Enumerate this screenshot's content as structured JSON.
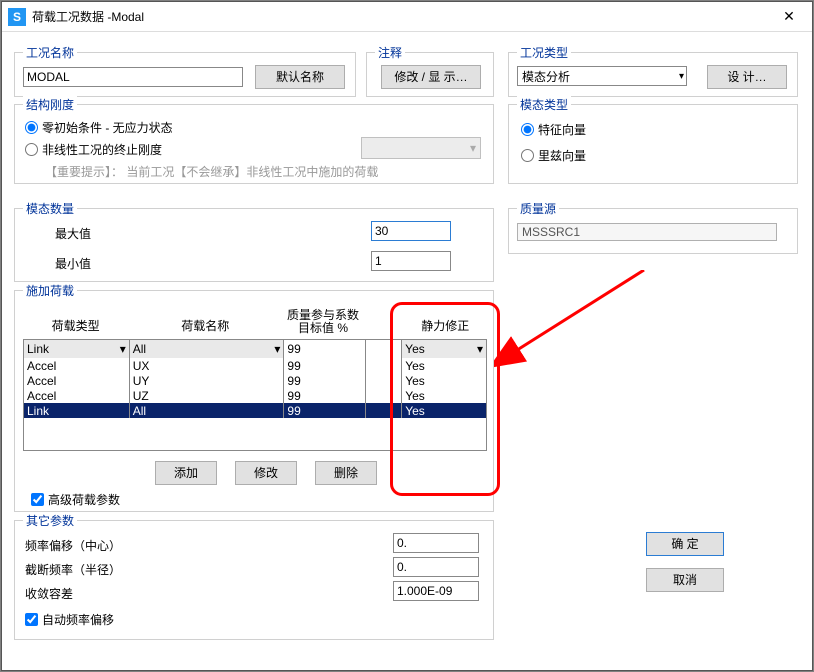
{
  "window": {
    "title": "荷载工况数据 -Modal",
    "app_letter": "S",
    "close_icon": "✕"
  },
  "group_name": {
    "title": "工况名称",
    "value": "MODAL",
    "default_btn": "默认名称"
  },
  "group_notes": {
    "title": "注释",
    "btn": "修改 / 显 示…"
  },
  "group_type": {
    "title": "工况类型",
    "value": "模态分析",
    "design_btn": "设 计…",
    "arrow": "▾"
  },
  "group_struct": {
    "title": "结构刚度",
    "radio1": "零初始条件 - 无应力状态",
    "radio2": "非线性工况的终止刚度",
    "hint": "【重要提示】：   当前工况【不会继承】非线性工况中施加的荷载",
    "dd_arrow": "▾"
  },
  "group_modal_type": {
    "title": "模态类型",
    "radio1": "特征向量",
    "radio2": "里兹向量"
  },
  "group_num": {
    "title": "模态数量",
    "max_label": "最大值",
    "max_value": "30",
    "min_label": "最小值",
    "min_value": "1"
  },
  "group_mass": {
    "title": "质量源",
    "value": "MSSSRC1"
  },
  "group_loads": {
    "title": "施加荷载",
    "hdr_type": "荷载类型",
    "hdr_name": "荷载名称",
    "hdr_target1": "质量参与系数",
    "hdr_target2": "目标值 %",
    "hdr_static": "静力修正",
    "row_head": {
      "a": "Link",
      "b": "All",
      "c": "99",
      "d": "Yes",
      "arrow": "▾"
    },
    "rows": [
      {
        "a": "Accel",
        "b": "UX",
        "c": "99",
        "d": "Yes"
      },
      {
        "a": "Accel",
        "b": "UY",
        "c": "99",
        "d": "Yes"
      },
      {
        "a": "Accel",
        "b": "UZ",
        "c": "99",
        "d": "Yes"
      },
      {
        "a": "Link",
        "b": "All",
        "c": "99",
        "d": "Yes",
        "sel": true
      }
    ],
    "btn_add": "添加",
    "btn_mod": "修改",
    "btn_del": "删除",
    "adv_check": "高级荷载参数"
  },
  "group_other": {
    "title": "其它参数",
    "freq_shift_label": "频率偏移（中心）",
    "freq_shift_val": "0.",
    "cutoff_label": "截断频率（半径）",
    "cutoff_val": "0.",
    "tol_label": "收敛容差",
    "tol_val": "1.000E-09",
    "auto_check": "自动频率偏移"
  },
  "buttons": {
    "ok": "确 定",
    "cancel": "取消"
  }
}
